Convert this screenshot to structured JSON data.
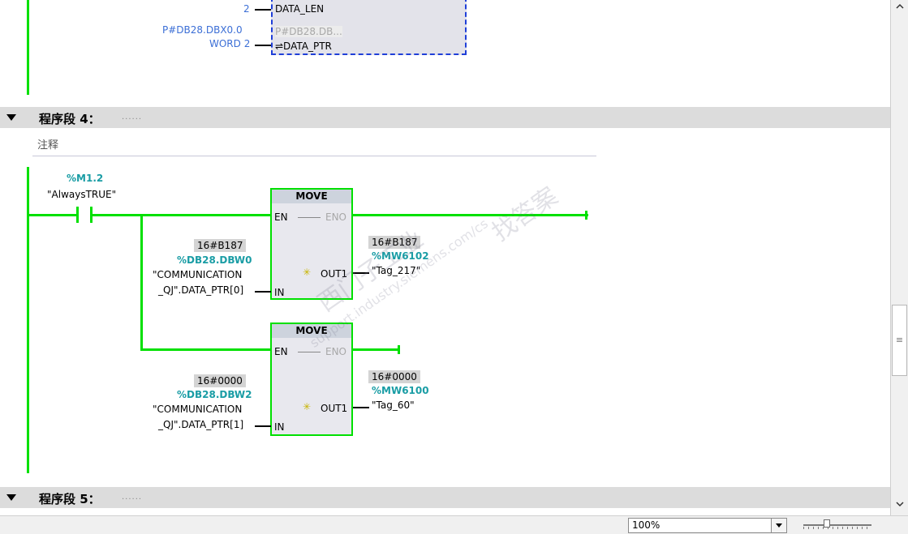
{
  "prev_network": {
    "data_len_input": "2",
    "data_len_pin": "DATA_LEN",
    "ptr_input_1": "P#DB28.DBX0.0",
    "ptr_input_2": "WORD 2",
    "ptr_value": "P#DB28.DB...",
    "ptr_pin": "⇌DATA_PTR"
  },
  "network4": {
    "title": "程序段 4：",
    "dots": "......",
    "comment": "注释",
    "contact_address": "%M1.2",
    "contact_tag": "\"AlwaysTRUE\"",
    "move1": {
      "header": "MOVE",
      "en": "EN",
      "eno": "ENO",
      "in_value": "16#B187",
      "in_address": "%DB28.DBW0",
      "in_tag_line1": "\"COMMUNICATION",
      "in_tag_line2": "_QJ\".DATA_PTR[0]",
      "in_pin": "IN",
      "out_pin": "OUT1",
      "out_value": "16#B187",
      "out_address": "%MW6102",
      "out_tag": "\"Tag_217\""
    },
    "move2": {
      "header": "MOVE",
      "en": "EN",
      "eno": "ENO",
      "in_value": "16#0000",
      "in_address": "%DB28.DBW2",
      "in_tag_line1": "\"COMMUNICATION",
      "in_tag_line2": "_QJ\".DATA_PTR[1]",
      "in_pin": "IN",
      "out_pin": "OUT1",
      "out_value": "16#0000",
      "out_address": "%MW6100",
      "out_tag": "\"Tag_60\""
    }
  },
  "network5": {
    "title": "程序段 5：",
    "dots": "......"
  },
  "status_bar": {
    "zoom_value": "100%"
  },
  "watermark": {
    "text1": "西门子工业",
    "text2": "找答案",
    "text3": "support.industry.siemens.com/cs"
  },
  "colors": {
    "power_flow": "#00e000",
    "address": "#1a9da5",
    "pointer_blue": "#3c6fd6"
  }
}
